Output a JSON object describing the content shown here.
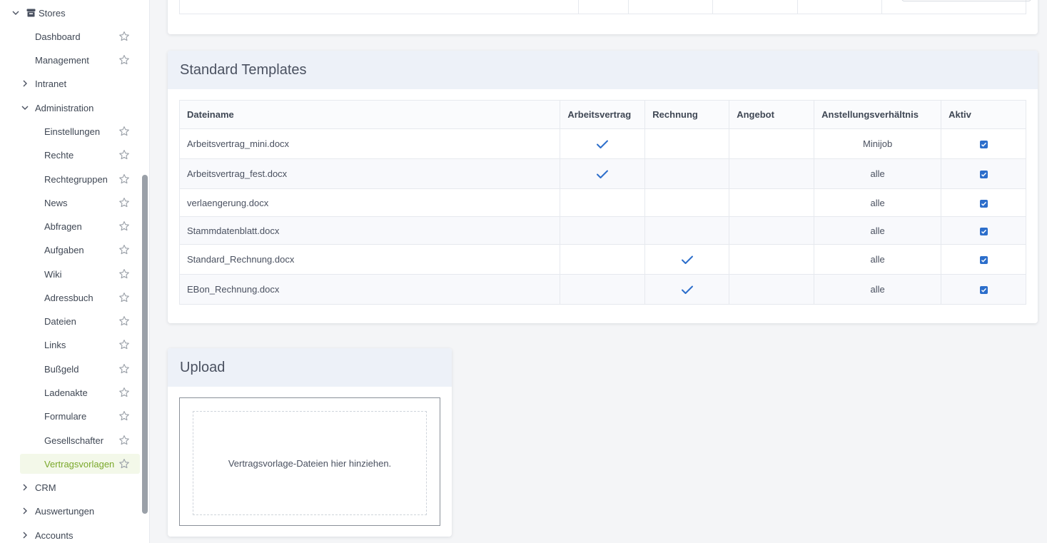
{
  "sidebar": {
    "items": [
      {
        "label": "Stores",
        "level": 0,
        "expanded": true,
        "icon": "store-icon"
      },
      {
        "label": "Dashboard",
        "level": 1,
        "star": true
      },
      {
        "label": "Management",
        "level": 1,
        "star": true
      },
      {
        "label": "Intranet",
        "level": 1,
        "expanded": false
      },
      {
        "label": "Administration",
        "level": 1,
        "expanded": true
      },
      {
        "label": "Einstellungen",
        "level": 2,
        "star": true
      },
      {
        "label": "Rechte",
        "level": 2,
        "star": true
      },
      {
        "label": "Rechtegruppen",
        "level": 2,
        "star": true
      },
      {
        "label": "News",
        "level": 2,
        "star": true
      },
      {
        "label": "Abfragen",
        "level": 2,
        "star": true
      },
      {
        "label": "Aufgaben",
        "level": 2,
        "star": true
      },
      {
        "label": "Wiki",
        "level": 2,
        "star": true
      },
      {
        "label": "Adressbuch",
        "level": 2,
        "star": true
      },
      {
        "label": "Dateien",
        "level": 2,
        "star": true
      },
      {
        "label": "Links",
        "level": 2,
        "star": true
      },
      {
        "label": "Bußgeld",
        "level": 2,
        "star": true
      },
      {
        "label": "Ladenakte",
        "level": 2,
        "star": true
      },
      {
        "label": "Formulare",
        "level": 2,
        "star": true
      },
      {
        "label": "Gesellschafter",
        "level": 2,
        "star": true
      },
      {
        "label": "Vertragsvorlagen",
        "level": 2,
        "star": true,
        "active": true
      },
      {
        "label": "CRM",
        "level": 1,
        "expanded": false
      },
      {
        "label": "Auswertungen",
        "level": 1,
        "expanded": false
      },
      {
        "label": "Accounts",
        "level": 1,
        "expanded": false
      }
    ]
  },
  "templates": {
    "title": "Standard Templates",
    "columns": [
      "Dateiname",
      "Arbeitsvertrag",
      "Rechnung",
      "Angebot",
      "Anstellungsverhältnis",
      "Aktiv"
    ],
    "rows": [
      {
        "file": "Arbeitsvertrag_mini.docx",
        "arbeitsvertrag": true,
        "rechnung": false,
        "angebot": false,
        "verhaeltnis": "Minijob",
        "aktiv": true
      },
      {
        "file": "Arbeitsvertrag_fest.docx",
        "arbeitsvertrag": true,
        "rechnung": false,
        "angebot": false,
        "verhaeltnis": "alle",
        "aktiv": true
      },
      {
        "file": "verlaengerung.docx",
        "arbeitsvertrag": false,
        "rechnung": false,
        "angebot": false,
        "verhaeltnis": "alle",
        "aktiv": true
      },
      {
        "file": "Stammdatenblatt.docx",
        "arbeitsvertrag": false,
        "rechnung": false,
        "angebot": false,
        "verhaeltnis": "alle",
        "aktiv": true
      },
      {
        "file": "Standard_Rechnung.docx",
        "arbeitsvertrag": false,
        "rechnung": true,
        "angebot": false,
        "verhaeltnis": "alle",
        "aktiv": true
      },
      {
        "file": "EBon_Rechnung.docx",
        "arbeitsvertrag": false,
        "rechnung": true,
        "angebot": false,
        "verhaeltnis": "alle",
        "aktiv": true
      }
    ]
  },
  "upload": {
    "title": "Upload",
    "dropzone_text": "Vertragsvorlage-Dateien hier hinziehen."
  },
  "colors": {
    "accent": "#2c6ecb",
    "active_nav_text": "#7aa82a",
    "active_nav_bg": "#f3f8e9",
    "card_header_bg": "#edf1f8"
  }
}
